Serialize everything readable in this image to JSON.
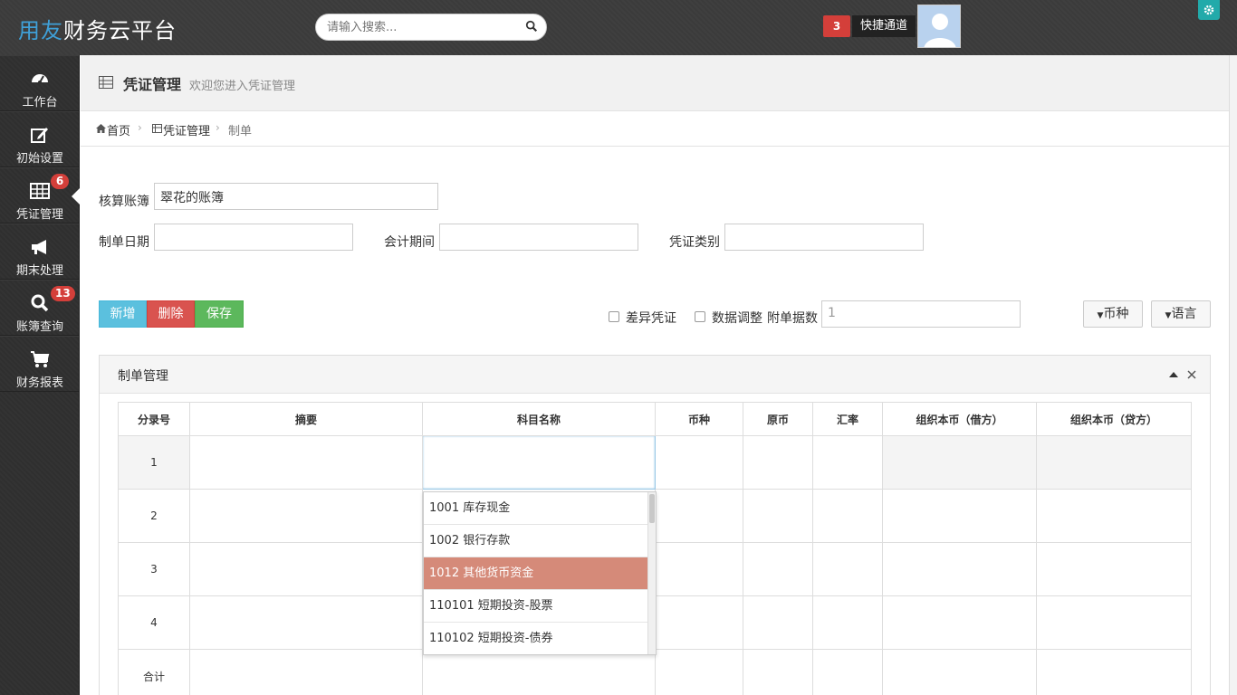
{
  "brand": {
    "accent": "用友",
    "rest": "财务云平台"
  },
  "search": {
    "placeholder": "请输入搜索..."
  },
  "topbar": {
    "notify_count": "3",
    "quick_link": "快捷通道"
  },
  "sidebar": {
    "items": [
      {
        "label": "工作台",
        "icon": "dashboard-icon",
        "badge": ""
      },
      {
        "label": "初始设置",
        "icon": "edit-icon",
        "badge": ""
      },
      {
        "label": "凭证管理",
        "icon": "table-icon",
        "badge": "6"
      },
      {
        "label": "期末处理",
        "icon": "bullhorn-icon",
        "badge": ""
      },
      {
        "label": "账簿查询",
        "icon": "search-icon",
        "badge": "13"
      },
      {
        "label": "财务报表",
        "icon": "cart-icon",
        "badge": ""
      }
    ]
  },
  "header": {
    "title": "凭证管理",
    "subtitle": "欢迎您进入凭证管理"
  },
  "breadcrumb": {
    "home": "首页",
    "section": "凭证管理",
    "current": "制单"
  },
  "form": {
    "ledger_label": "核算账簿",
    "ledger_value": "翠花的账簿",
    "date_label": "制单日期",
    "period_label": "会计期间",
    "type_label": "凭证类别",
    "diff_label": "差异凭证",
    "adjust_label": "数据调整",
    "attach_label": "附单据数",
    "attach_value": "1"
  },
  "toolbar": {
    "add": "新增",
    "delete": "删除",
    "save": "保存",
    "currency": "币种",
    "language": "语言"
  },
  "panel": {
    "title": "制单管理"
  },
  "table": {
    "headers": [
      "分录号",
      "摘要",
      "科目名称",
      "币种",
      "原币",
      "汇率",
      "组织本币（借方）",
      "组织本币（贷方）"
    ],
    "rows": [
      "1",
      "2",
      "3",
      "4"
    ],
    "total_label": "合计"
  },
  "account_dropdown": {
    "items": [
      "1001 库存现金",
      "1002 银行存款",
      "1012 其他货币资金",
      "110101 短期投资-股票",
      "110102 短期投资-债券"
    ],
    "selected_index": 2
  },
  "colors": {
    "accent_blue": "#3fa0d8",
    "danger": "#d43f3a",
    "success": "#5cb85c",
    "info": "#5bc0de",
    "selection": "#d58a79"
  }
}
